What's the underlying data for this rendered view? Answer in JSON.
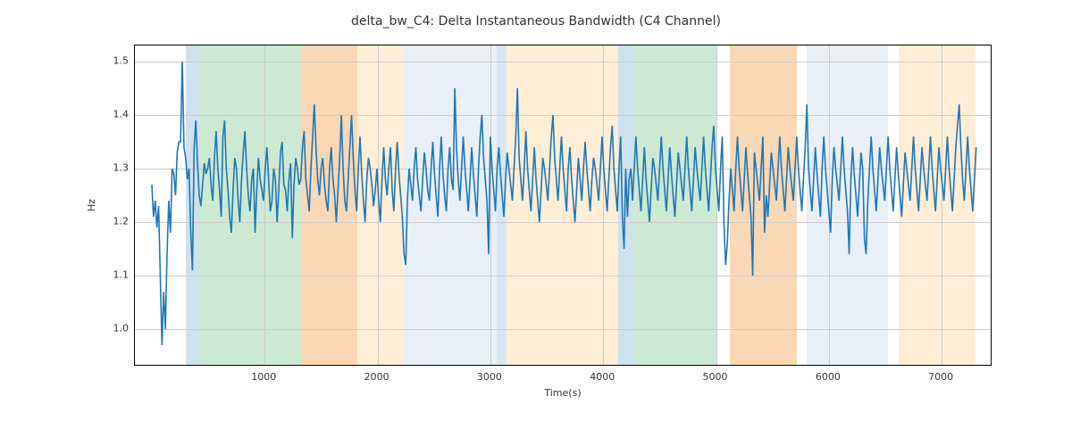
{
  "chart_data": {
    "type": "line",
    "title": "delta_bw_C4: Delta Instantaneous Bandwidth (C4 Channel)",
    "xlabel": "Time(s)",
    "ylabel": "Hz",
    "xlim": [
      -150,
      7450
    ],
    "ylim": [
      0.93,
      1.53
    ],
    "x_ticks": [
      1000,
      2000,
      3000,
      4000,
      5000,
      6000,
      7000
    ],
    "y_ticks": [
      1.0,
      1.1,
      1.2,
      1.3,
      1.4,
      1.5
    ],
    "bands": [
      {
        "start": 300,
        "end": 430,
        "color": "#a6c8e4",
        "alpha": 0.55
      },
      {
        "start": 430,
        "end": 1320,
        "color": "#8fd19e",
        "alpha": 0.45
      },
      {
        "start": 1320,
        "end": 1820,
        "color": "#f5b26b",
        "alpha": 0.5
      },
      {
        "start": 1820,
        "end": 2230,
        "color": "#ffe0b2",
        "alpha": 0.55
      },
      {
        "start": 2230,
        "end": 3060,
        "color": "#dbe7f3",
        "alpha": 0.65
      },
      {
        "start": 3060,
        "end": 3140,
        "color": "#a6c8e4",
        "alpha": 0.45
      },
      {
        "start": 3140,
        "end": 4130,
        "color": "#ffe0b2",
        "alpha": 0.55
      },
      {
        "start": 4130,
        "end": 4270,
        "color": "#a6c8e4",
        "alpha": 0.55
      },
      {
        "start": 4270,
        "end": 5010,
        "color": "#8fd19e",
        "alpha": 0.45
      },
      {
        "start": 5010,
        "end": 5120,
        "color": "#ffffff",
        "alpha": 0.0
      },
      {
        "start": 5120,
        "end": 5720,
        "color": "#f5b26b",
        "alpha": 0.5
      },
      {
        "start": 5720,
        "end": 5800,
        "color": "#ffffff",
        "alpha": 0.0
      },
      {
        "start": 5800,
        "end": 6520,
        "color": "#dbe7f3",
        "alpha": 0.65
      },
      {
        "start": 6520,
        "end": 6620,
        "color": "#ffffff",
        "alpha": 0.0
      },
      {
        "start": 6620,
        "end": 7300,
        "color": "#ffe0b2",
        "alpha": 0.55
      }
    ],
    "series": [
      {
        "name": "delta_bw_C4",
        "x_start": 0,
        "x_step": 15,
        "values": [
          1.27,
          1.21,
          1.24,
          1.19,
          1.23,
          1.1,
          0.97,
          1.07,
          1.0,
          1.14,
          1.24,
          1.18,
          1.3,
          1.29,
          1.25,
          1.33,
          1.35,
          1.35,
          1.5,
          1.34,
          1.32,
          1.28,
          1.3,
          1.18,
          1.11,
          1.34,
          1.39,
          1.31,
          1.25,
          1.23,
          1.27,
          1.31,
          1.29,
          1.3,
          1.32,
          1.27,
          1.24,
          1.32,
          1.37,
          1.3,
          1.26,
          1.21,
          1.36,
          1.39,
          1.3,
          1.26,
          1.21,
          1.18,
          1.26,
          1.32,
          1.3,
          1.24,
          1.2,
          1.28,
          1.33,
          1.37,
          1.3,
          1.25,
          1.22,
          1.28,
          1.3,
          1.18,
          1.26,
          1.32,
          1.28,
          1.26,
          1.24,
          1.3,
          1.34,
          1.28,
          1.22,
          1.24,
          1.3,
          1.28,
          1.2,
          1.26,
          1.33,
          1.35,
          1.27,
          1.26,
          1.22,
          1.28,
          1.31,
          1.17,
          1.27,
          1.32,
          1.3,
          1.27,
          1.28,
          1.34,
          1.37,
          1.28,
          1.25,
          1.22,
          1.3,
          1.36,
          1.42,
          1.34,
          1.28,
          1.25,
          1.3,
          1.32,
          1.27,
          1.24,
          1.22,
          1.3,
          1.34,
          1.28,
          1.25,
          1.2,
          1.26,
          1.32,
          1.4,
          1.3,
          1.24,
          1.22,
          1.28,
          1.34,
          1.4,
          1.32,
          1.26,
          1.22,
          1.3,
          1.36,
          1.29,
          1.24,
          1.2,
          1.28,
          1.32,
          1.3,
          1.27,
          1.23,
          1.26,
          1.3,
          1.24,
          1.2,
          1.28,
          1.34,
          1.28,
          1.25,
          1.3,
          1.34,
          1.26,
          1.22,
          1.3,
          1.35,
          1.29,
          1.25,
          1.21,
          1.14,
          1.12,
          1.24,
          1.3,
          1.27,
          1.24,
          1.3,
          1.34,
          1.28,
          1.25,
          1.22,
          1.28,
          1.33,
          1.3,
          1.26,
          1.24,
          1.3,
          1.35,
          1.29,
          1.25,
          1.21,
          1.3,
          1.36,
          1.29,
          1.25,
          1.22,
          1.3,
          1.34,
          1.28,
          1.26,
          1.45,
          1.34,
          1.28,
          1.24,
          1.3,
          1.36,
          1.3,
          1.26,
          1.22,
          1.28,
          1.34,
          1.29,
          1.25,
          1.21,
          1.3,
          1.36,
          1.4,
          1.32,
          1.28,
          1.24,
          1.14,
          1.36,
          1.3,
          1.26,
          1.22,
          1.3,
          1.34,
          1.29,
          1.25,
          1.21,
          1.28,
          1.33,
          1.3,
          1.27,
          1.24,
          1.3,
          1.36,
          1.45,
          1.32,
          1.28,
          1.24,
          1.3,
          1.37,
          1.3,
          1.26,
          1.22,
          1.28,
          1.34,
          1.28,
          1.24,
          1.2,
          1.26,
          1.32,
          1.3,
          1.27,
          1.24,
          1.3,
          1.36,
          1.4,
          1.32,
          1.28,
          1.24,
          1.3,
          1.36,
          1.3,
          1.26,
          1.22,
          1.3,
          1.34,
          1.28,
          1.24,
          1.2,
          1.26,
          1.32,
          1.28,
          1.24,
          1.3,
          1.35,
          1.3,
          1.26,
          1.22,
          1.28,
          1.32,
          1.3,
          1.27,
          1.24,
          1.3,
          1.36,
          1.3,
          1.26,
          1.22,
          1.28,
          1.34,
          1.38,
          1.3,
          1.26,
          1.22,
          1.3,
          1.36,
          1.21,
          1.15,
          1.3,
          1.21,
          1.28,
          1.3,
          1.24,
          1.3,
          1.36,
          1.3,
          1.26,
          1.22,
          1.28,
          1.34,
          1.28,
          1.24,
          1.2,
          1.26,
          1.32,
          1.3,
          1.27,
          1.24,
          1.3,
          1.36,
          1.3,
          1.26,
          1.22,
          1.28,
          1.34,
          1.29,
          1.25,
          1.21,
          1.27,
          1.33,
          1.3,
          1.27,
          1.24,
          1.3,
          1.36,
          1.3,
          1.26,
          1.22,
          1.28,
          1.34,
          1.3,
          1.27,
          1.24,
          1.3,
          1.36,
          1.3,
          1.26,
          1.22,
          1.28,
          1.34,
          1.38,
          1.3,
          1.26,
          1.22,
          1.3,
          1.36,
          1.2,
          1.12,
          1.16,
          1.24,
          1.3,
          1.26,
          1.22,
          1.3,
          1.36,
          1.3,
          1.26,
          1.22,
          1.28,
          1.34,
          1.29,
          1.25,
          1.21,
          1.1,
          1.33,
          1.3,
          1.27,
          1.24,
          1.3,
          1.36,
          1.18,
          1.25,
          1.21,
          1.27,
          1.33,
          1.3,
          1.27,
          1.24,
          1.3,
          1.36,
          1.3,
          1.26,
          1.22,
          1.28,
          1.34,
          1.3,
          1.27,
          1.24,
          1.3,
          1.36,
          1.3,
          1.26,
          1.22,
          1.28,
          1.34,
          1.42,
          1.3,
          1.26,
          1.22,
          1.28,
          1.34,
          1.29,
          1.25,
          1.21,
          1.3,
          1.36,
          1.3,
          1.26,
          1.22,
          1.18,
          1.28,
          1.34,
          1.3,
          1.27,
          1.24,
          1.3,
          1.36,
          1.3,
          1.26,
          1.22,
          1.14,
          1.28,
          1.34,
          1.29,
          1.25,
          1.21,
          1.27,
          1.33,
          1.3,
          1.17,
          1.14,
          1.24,
          1.3,
          1.36,
          1.3,
          1.26,
          1.22,
          1.28,
          1.34,
          1.3,
          1.27,
          1.24,
          1.3,
          1.36,
          1.3,
          1.26,
          1.22,
          1.28,
          1.34,
          1.29,
          1.25,
          1.21,
          1.27,
          1.33,
          1.3,
          1.27,
          1.24,
          1.3,
          1.36,
          1.3,
          1.26,
          1.22,
          1.28,
          1.34,
          1.3,
          1.27,
          1.24,
          1.3,
          1.36,
          1.3,
          1.26,
          1.22,
          1.28,
          1.34,
          1.3,
          1.27,
          1.24,
          1.3,
          1.36,
          1.3,
          1.26,
          1.22,
          1.28,
          1.34,
          1.38,
          1.42,
          1.34,
          1.28,
          1.24,
          1.3,
          1.36,
          1.3,
          1.26,
          1.22,
          1.28,
          1.34
        ]
      }
    ]
  }
}
